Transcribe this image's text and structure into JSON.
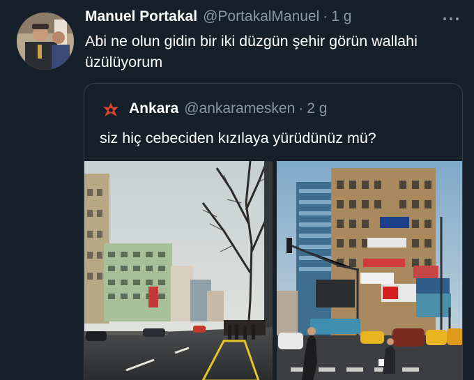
{
  "tweet": {
    "display_name": "Manuel Portakal",
    "handle": "@PortakalManuel",
    "separator": "·",
    "time": "1 g",
    "text": "Abi ne olun gidin bir iki düzgün şehir görün wallahi üzülüyorum"
  },
  "quoted_tweet": {
    "display_name": "Ankara",
    "handle": "@ankaramesken",
    "separator": "·",
    "time": "2 g",
    "text": "siz hiç cebeciden kızılaya yürüdünüz mü?"
  },
  "icons": {
    "more": "more-horizontal-icon",
    "quote_avatar": "ankara-logo-icon"
  },
  "colors": {
    "background": "#15202b",
    "secondary_text": "#8899a6",
    "border": "#38444d"
  }
}
